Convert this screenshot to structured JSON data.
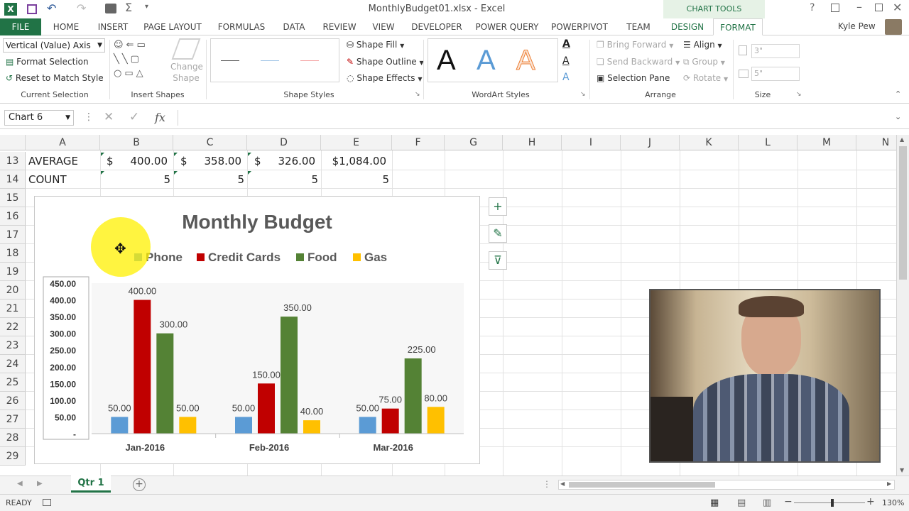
{
  "window": {
    "title": "MonthlyBudget01.xlsx - Excel",
    "context_tab_group": "CHART TOOLS",
    "user": "Kyle Pew"
  },
  "ribbon_tabs": [
    {
      "label": "FILE"
    },
    {
      "label": "HOME"
    },
    {
      "label": "INSERT"
    },
    {
      "label": "PAGE LAYOUT"
    },
    {
      "label": "FORMULAS"
    },
    {
      "label": "DATA"
    },
    {
      "label": "REVIEW"
    },
    {
      "label": "VIEW"
    },
    {
      "label": "DEVELOPER"
    },
    {
      "label": "POWER QUERY"
    },
    {
      "label": "POWERPIVOT"
    },
    {
      "label": "TEAM"
    },
    {
      "label": "DESIGN"
    },
    {
      "label": "FORMAT"
    }
  ],
  "ribbon": {
    "selection_dropdown": "Vertical (Value) Axis",
    "format_selection": "Format Selection",
    "reset_to_match_style": "Reset to Match Style",
    "group_current_selection": "Current Selection",
    "change_shape_line1": "Change",
    "change_shape_line2": "Shape",
    "group_insert_shapes": "Insert Shapes",
    "shape_fill": "Shape Fill",
    "shape_outline": "Shape Outline",
    "shape_effects": "Shape Effects",
    "group_shape_styles": "Shape Styles",
    "wordart_letter": "A",
    "group_wordart_styles": "WordArt Styles",
    "bring_forward": "Bring Forward",
    "send_backward": "Send Backward",
    "selection_pane": "Selection Pane",
    "align": "Align",
    "group": "Group",
    "rotate": "Rotate",
    "group_arrange": "Arrange",
    "height_value": "3\"",
    "width_value": "5\"",
    "group_size": "Size"
  },
  "formula_bar": {
    "name_box": "Chart 6",
    "fx": "fx",
    "formula": ""
  },
  "columns": [
    "A",
    "B",
    "C",
    "D",
    "E",
    "F",
    "G",
    "H",
    "I",
    "J",
    "K",
    "L",
    "M",
    "N"
  ],
  "rows": [
    "13",
    "14",
    "15",
    "16",
    "17",
    "18",
    "19",
    "20",
    "21",
    "22",
    "23",
    "24",
    "25",
    "26",
    "27",
    "28",
    "29"
  ],
  "cells": {
    "a13": "AVERAGE",
    "b13_sym": "$",
    "b13": "400.00",
    "c13_sym": "$",
    "c13": "358.00",
    "d13_sym": "$",
    "d13": "326.00",
    "e13": "$1,084.00",
    "a14": "COUNT",
    "b14": "5",
    "c14": "5",
    "d14": "5",
    "e14": "5"
  },
  "chart_data": {
    "type": "bar",
    "title": "Monthly Budget",
    "categories": [
      "Jan-2016",
      "Feb-2016",
      "Mar-2016"
    ],
    "series": [
      {
        "name": "Phone",
        "color": "#5b9bd5",
        "values": [
          50,
          50,
          50
        ]
      },
      {
        "name": "Credit Cards",
        "color": "#c00000",
        "values": [
          400,
          150,
          75
        ]
      },
      {
        "name": "Food",
        "color": "#548235",
        "values": [
          300,
          350,
          225
        ]
      },
      {
        "name": "Gas",
        "color": "#ffc000",
        "values": [
          50,
          40,
          80
        ]
      }
    ],
    "value_labels": [
      [
        "50.00",
        "400.00",
        "300.00",
        "50.00"
      ],
      [
        "50.00",
        "150.00",
        "350.00",
        "40.00"
      ],
      [
        "50.00",
        "75.00",
        "225.00",
        "80.00"
      ]
    ],
    "y_ticks": [
      "-",
      "50.00",
      "100.00",
      "150.00",
      "200.00",
      "250.00",
      "300.00",
      "350.00",
      "400.00",
      "450.00"
    ],
    "ylim": [
      0,
      450
    ],
    "legend_position": "top",
    "grid": false
  },
  "chart_side_buttons": [
    {
      "icon": "plus-icon",
      "glyph": "+"
    },
    {
      "icon": "brush-icon",
      "glyph": "✎"
    },
    {
      "icon": "filter-icon",
      "glyph": "⊽"
    }
  ],
  "sheet_tabs": [
    {
      "label": "Qtr 1"
    }
  ],
  "status": {
    "ready": "READY",
    "zoom": "130%"
  },
  "colors": {
    "excel_green": "#217346",
    "context_tab_bg": "#e6f2e6"
  }
}
